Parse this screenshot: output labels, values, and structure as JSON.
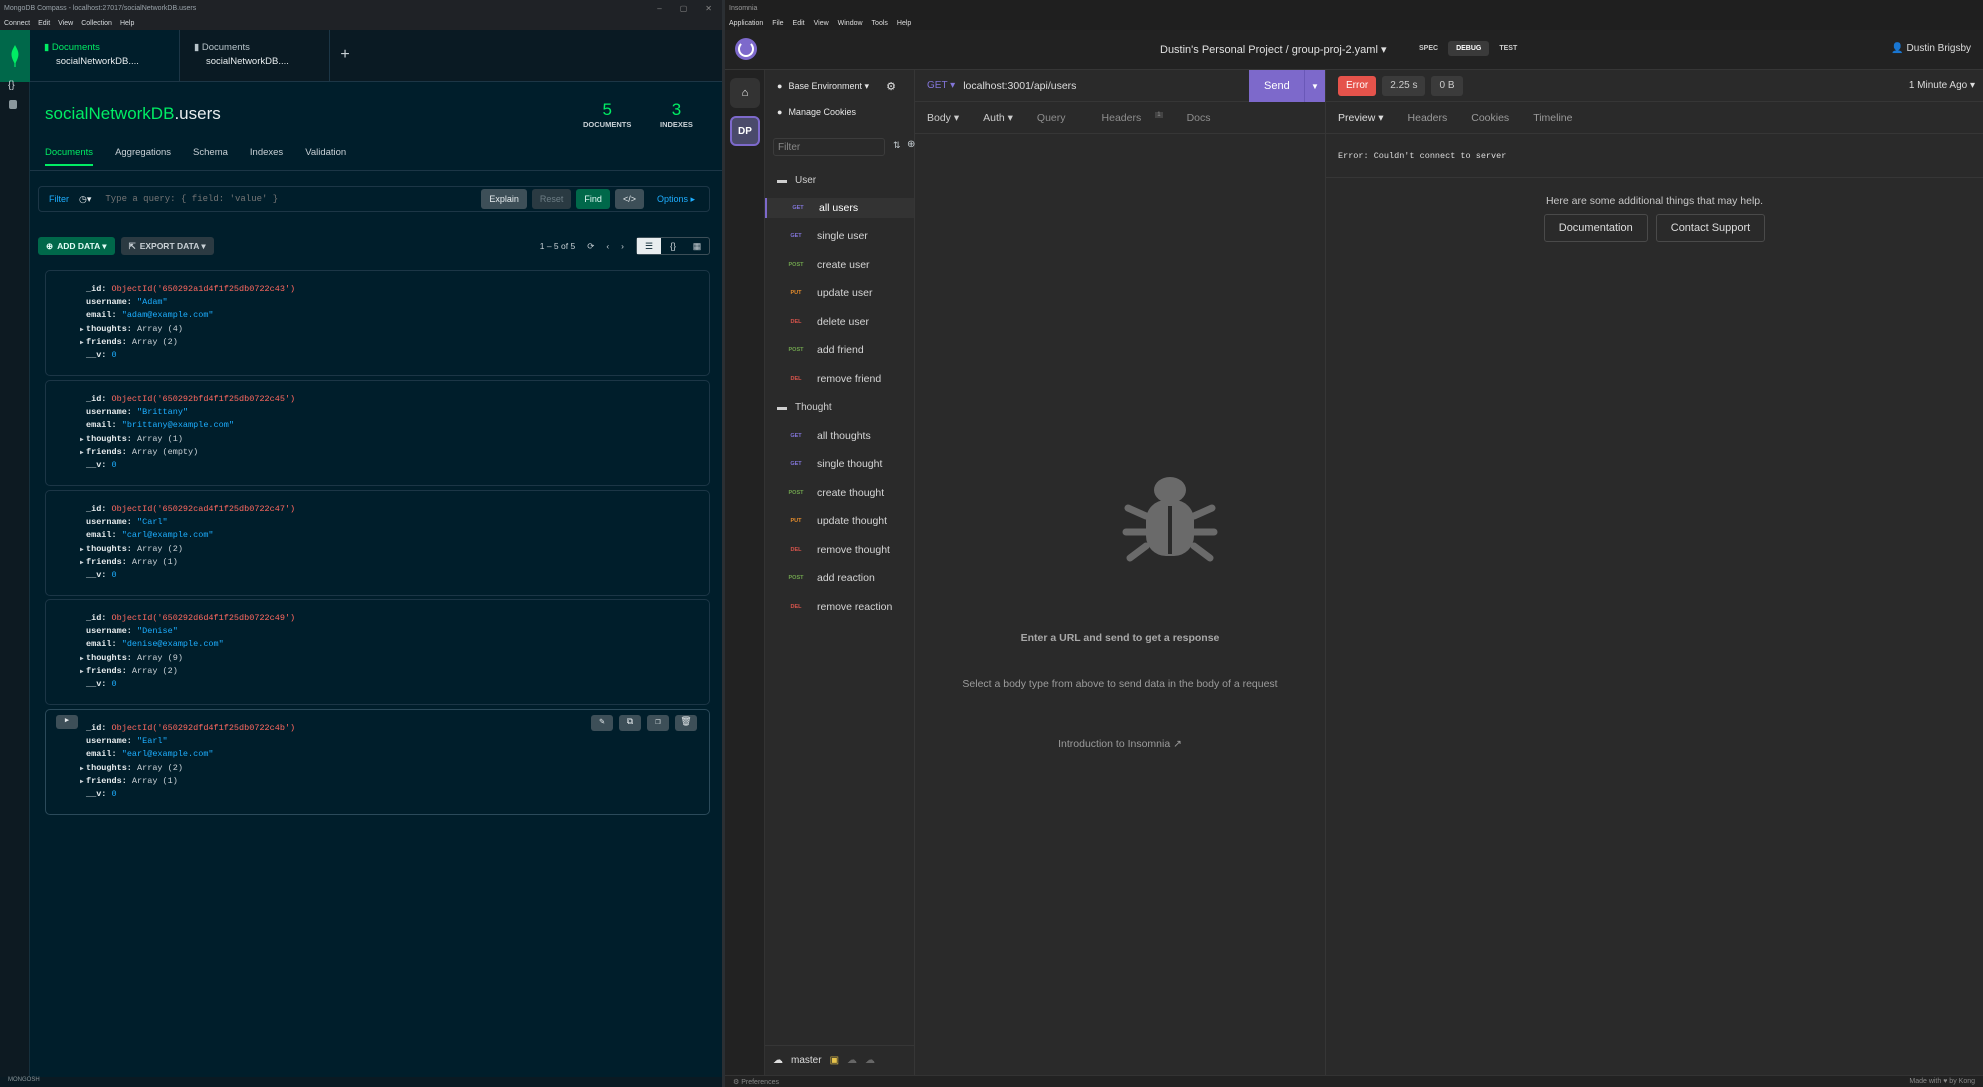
{
  "compass": {
    "window_title": "MongoDB Compass - localhost:27017/socialNetworkDB.users",
    "menu": [
      "Connect",
      "Edit",
      "View",
      "Collection",
      "Help"
    ],
    "tabs": [
      {
        "title": "Documents",
        "subtitle": "socialNetworkDB...."
      },
      {
        "title": "Documents",
        "subtitle": "socialNetworkDB...."
      }
    ],
    "tab_add": "+",
    "collection": {
      "db": "socialNetworkDB",
      "name": ".users"
    },
    "stats": {
      "documents": {
        "value": "5",
        "label": "DOCUMENTS"
      },
      "indexes": {
        "value": "3",
        "label": "INDEXES"
      }
    },
    "subtabs": [
      "Documents",
      "Aggregations",
      "Schema",
      "Indexes",
      "Validation"
    ],
    "query": {
      "filter_label": "Filter",
      "placeholder": "Type a query: { field: 'value' }",
      "explain": "Explain",
      "reset": "Reset",
      "find": "Find",
      "options": "Options ▸"
    },
    "toolbar": {
      "add_data": "ADD DATA ▾",
      "export_data": "EXPORT DATA ▾",
      "pagination": "1 – 5 of 5"
    },
    "documents": [
      {
        "id": "ObjectId('650292a1d4f1f25db0722c43')",
        "username": "\"Adam\"",
        "email": "\"adam@example.com\"",
        "thoughts": "Array (4)",
        "friends": "Array (2)",
        "v": "0"
      },
      {
        "id": "ObjectId('650292bfd4f1f25db0722c45')",
        "username": "\"Brittany\"",
        "email": "\"brittany@example.com\"",
        "thoughts": "Array (1)",
        "friends": "Array (empty)",
        "v": "0"
      },
      {
        "id": "ObjectId('650292cad4f1f25db0722c47')",
        "username": "\"Carl\"",
        "email": "\"carl@example.com\"",
        "thoughts": "Array (2)",
        "friends": "Array (1)",
        "v": "0"
      },
      {
        "id": "ObjectId('650292d6d4f1f25db0722c49')",
        "username": "\"Denise\"",
        "email": "\"denise@example.com\"",
        "thoughts": "Array (9)",
        "friends": "Array (2)",
        "v": "0"
      },
      {
        "id": "ObjectId('650292dfd4f1f25db0722c4b')",
        "username": "\"Earl\"",
        "email": "\"earl@example.com\"",
        "thoughts": "Array (2)",
        "friends": "Array (1)",
        "v": "0"
      }
    ],
    "keys": {
      "id": "_id:",
      "username": "username:",
      "email": "email:",
      "thoughts": "thoughts:",
      "friends": "friends:",
      "v": "__v:"
    },
    "footer": "MONGOSH",
    "colors": {
      "accent": "#00ed64",
      "background": "#001e2b",
      "string": "#1daeff",
      "objectid": "#ff6960"
    }
  },
  "insomnia": {
    "window_title": "Insomnia",
    "menu": [
      "Application",
      "File",
      "Edit",
      "View",
      "Window",
      "Tools",
      "Help"
    ],
    "breadcrumb": "Dustin's Personal Project  /  group-proj-2.yaml ▾",
    "modes": [
      "SPEC",
      "DEBUG",
      "TEST"
    ],
    "user": "Dustin Brigsby",
    "rail_avatar": "DP",
    "environment": "Base Environment ▾",
    "manage_cookies": "Manage Cookies",
    "filter_placeholder": "Filter",
    "folders": [
      {
        "name": "User",
        "requests": [
          {
            "method": "GET",
            "name": "all users"
          },
          {
            "method": "GET",
            "name": "single user"
          },
          {
            "method": "POST",
            "name": "create user"
          },
          {
            "method": "PUT",
            "name": "update user"
          },
          {
            "method": "DEL",
            "name": "delete user"
          },
          {
            "method": "POST",
            "name": "add friend"
          },
          {
            "method": "DEL",
            "name": "remove friend"
          }
        ]
      },
      {
        "name": "Thought",
        "requests": [
          {
            "method": "GET",
            "name": "all thoughts"
          },
          {
            "method": "GET",
            "name": "single thought"
          },
          {
            "method": "POST",
            "name": "create thought"
          },
          {
            "method": "PUT",
            "name": "update thought"
          },
          {
            "method": "DEL",
            "name": "remove thought"
          },
          {
            "method": "POST",
            "name": "add reaction"
          },
          {
            "method": "DEL",
            "name": "remove reaction"
          }
        ]
      }
    ],
    "branch": "master",
    "request": {
      "method": "GET ▾",
      "url": "localhost:3001/api/users",
      "send": "Send",
      "tabs": [
        "Body ▾",
        "Auth ▾",
        "Query",
        "Headers",
        "Docs"
      ],
      "headers_count": "1",
      "empty_title": "Enter a URL and send to get a response",
      "empty_sub": "Select a body type from above to send data in the body of a request",
      "intro_link": "Introduction to Insomnia ↗"
    },
    "response": {
      "status": "Error",
      "time": "2.25 s",
      "size": "0 B",
      "ago": "1 Minute Ago ▾",
      "tabs": [
        "Preview ▾",
        "Headers",
        "Cookies",
        "Timeline"
      ],
      "error": "Error: Couldn't connect to server",
      "help": "Here are some additional things that may help.",
      "buttons": [
        "Documentation",
        "Contact Support"
      ]
    },
    "footer": {
      "left": "⚙  Preferences",
      "right": "Made with ♥ by Kong"
    },
    "colors": {
      "accent": "#7d69cb",
      "error": "#e5534b",
      "get": "#8275d8",
      "post": "#6fa24d",
      "put": "#e38b2c",
      "delete": "#d8544c"
    }
  }
}
